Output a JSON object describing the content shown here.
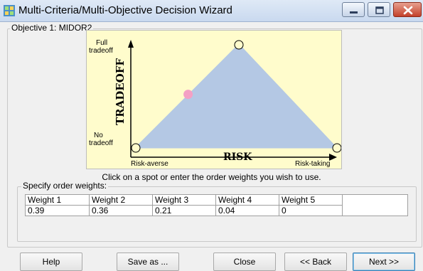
{
  "window": {
    "title": "Multi-Criteria/Multi-Objective Decision Wizard"
  },
  "objective": {
    "label": "Objective 1: MIDOR2"
  },
  "chart": {
    "y_axis_title": "TRADEOFF",
    "y_top_label_1": "Full",
    "y_top_label_2": "tradeoff",
    "y_bottom_label_1": "No",
    "y_bottom_label_2": "tradeoff",
    "x_axis_title": "RISK",
    "x_left_label": "Risk-averse",
    "x_right_label": "Risk-taking",
    "colors": {
      "triangle": "#b4c8e4",
      "marker": "#f4a0c4",
      "panel": "#fffccc"
    },
    "marker_position": {
      "risk": 0.26,
      "tradeoff": 0.52
    }
  },
  "instruction": "Click on a spot or enter the order weights you wish to use.",
  "weights": {
    "label": "Specify order weights:",
    "headers": [
      "Weight 1",
      "Weight 2",
      "Weight 3",
      "Weight 4",
      "Weight 5"
    ],
    "values": [
      "0.39",
      "0.36",
      "0.21",
      "0.04",
      "0"
    ]
  },
  "buttons": {
    "help": "Help",
    "save_as": "Save as ...",
    "close": "Close",
    "back": "<< Back",
    "next": "Next >>"
  }
}
